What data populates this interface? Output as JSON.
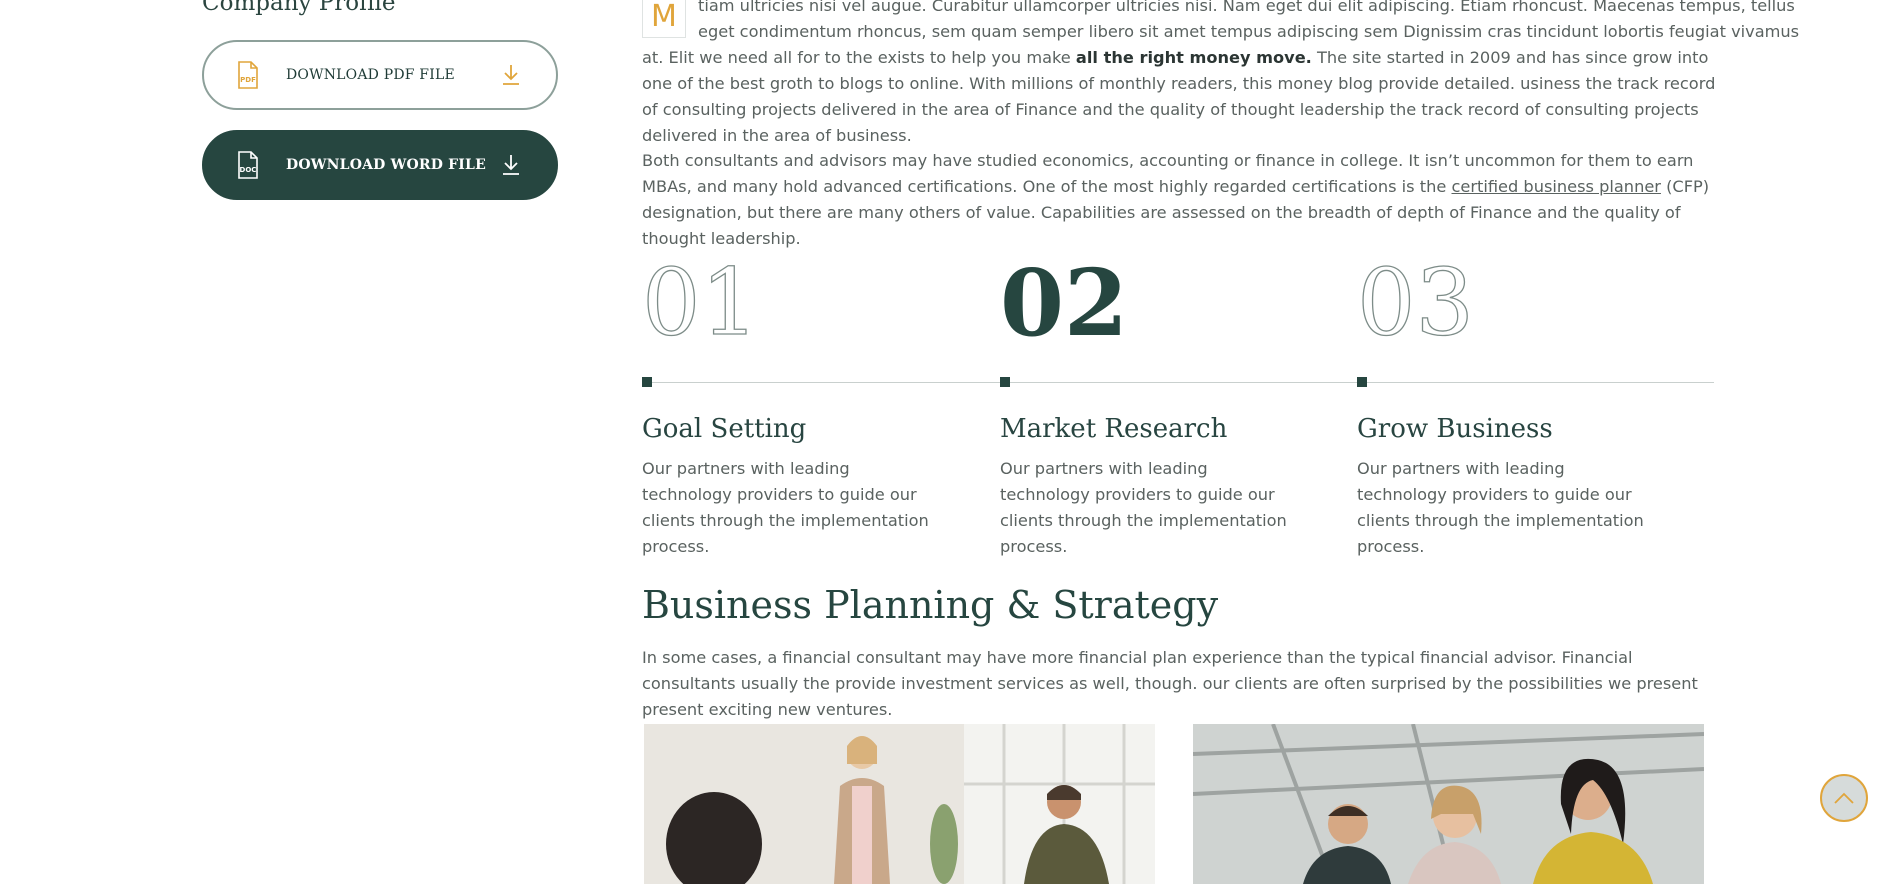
{
  "sidebar": {
    "title": "Company Profile",
    "pdf_button": {
      "label": "DOWNLOAD PDF FILE",
      "icon": "pdf-file-icon",
      "action_icon": "download-icon"
    },
    "word_button": {
      "label": "DOWNLOAD WORD FILE",
      "icon": "doc-file-icon",
      "action_icon": "download-icon"
    }
  },
  "intro": {
    "dropcap": "M",
    "line1": "tiam ultricies nisi vel augue. Curabitur ullamcorper ultricies nisi. Nam eget dui elit adipiscing. Etiam rhoncust. Maecenas tempus, tellus",
    "line2": "eget condimentum rhoncus, sem quam semper libero sit amet tempus adipiscing sem Dignissim cras tincidunt lobortis feugiat vivamus",
    "rest_before": "at. Elit we need all for to the exists to help you make ",
    "rest_bold": "all the right money move.",
    "rest_after": " The site started in 2009 and has since grow into one of the best groth to blogs to online. With millions of monthly readers, this money blog provide detailed. usiness the track record of consulting projects delivered in the area of Finance and the quality of thought leadership the track record of consulting projects delivered in the area of business."
  },
  "paragraph2": {
    "before": "Both consultants and advisors may have studied economics, accounting or finance in college. It isn’t uncommon for them to earn MBAs, and many hold advanced certifications. One of the most highly regarded certifications is the ",
    "link": "certified business planner",
    "after": " (CFP) designation, but there are many others of value. Capabilities are assessed on the breadth of depth of Finance and the quality of thought leadership."
  },
  "steps": [
    {
      "number": "01",
      "title": "Goal Setting",
      "text": "Our partners with leading technology providers to guide our clients through the implementation process."
    },
    {
      "number": "02",
      "title": "Market Research",
      "text": "Our partners with leading technology providers to guide our clients through the implementation process."
    },
    {
      "number": "03",
      "title": "Grow Business",
      "text": "Our partners with leading technology providers to guide our clients through the implementation process."
    }
  ],
  "section": {
    "title": "Business Planning & Strategy",
    "text": "In some cases, a financial consultant may have more financial plan experience than the typical financial advisor. Financial consultants usually the provide investment services as well, though. our clients are often surprised by the possibilities we present present exciting new ventures."
  },
  "scroll_top": {
    "icon": "chevron-up-icon"
  },
  "colors": {
    "primary": "#264640",
    "accent": "#e0a53b",
    "text": "#5a6260"
  }
}
